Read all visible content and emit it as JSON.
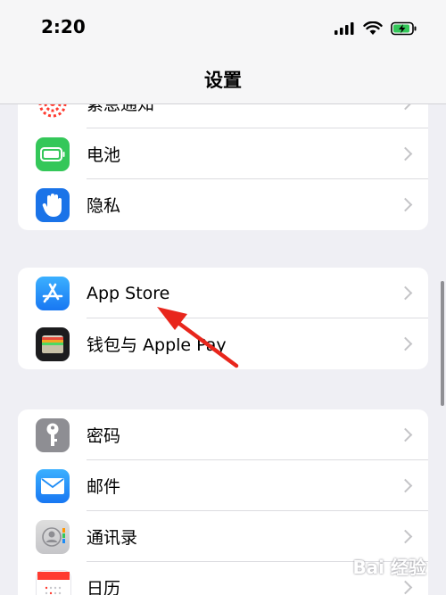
{
  "status": {
    "time": "2:20"
  },
  "nav": {
    "title": "设置"
  },
  "groups": [
    {
      "items": [
        {
          "label": "紧急通知",
          "icon": "exposure-notification-icon",
          "color": "#ff3b30"
        },
        {
          "label": "电池",
          "icon": "battery-icon",
          "color": "#34c759"
        },
        {
          "label": "隐私",
          "icon": "hand-privacy-icon",
          "color": "#1a73e8"
        }
      ]
    },
    {
      "items": [
        {
          "label": "App Store",
          "icon": "app-store-icon",
          "color": "#1e8cf5"
        },
        {
          "label": "钱包与 Apple Pay",
          "icon": "wallet-icon",
          "color": "#1c1c1e"
        }
      ]
    },
    {
      "items": [
        {
          "label": "密码",
          "icon": "key-icon",
          "color": "#8e8e93"
        },
        {
          "label": "邮件",
          "icon": "mail-icon",
          "color": "#1e8cf5"
        },
        {
          "label": "通讯录",
          "icon": "contacts-icon",
          "color": "#c7c7cc"
        },
        {
          "label": "日历",
          "icon": "calendar-icon",
          "color": "#ffffff"
        }
      ]
    }
  ],
  "watermark": {
    "text": "Bai 经验"
  }
}
